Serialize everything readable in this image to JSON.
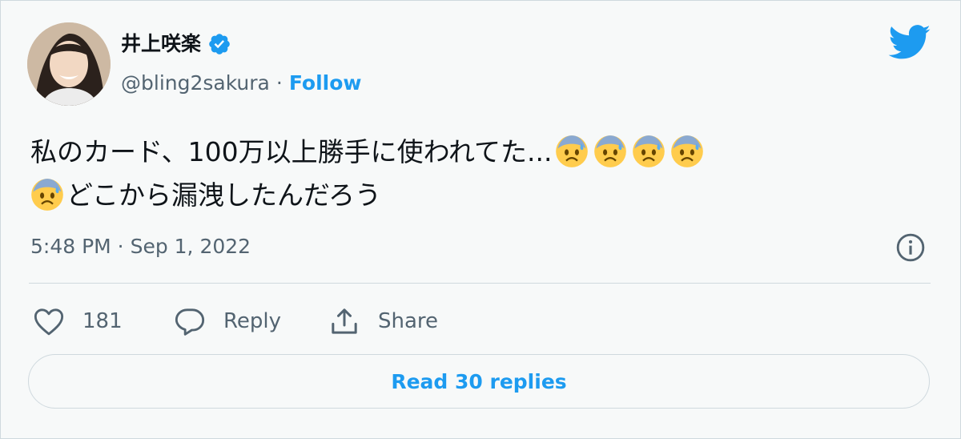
{
  "author": {
    "display_name": "井上咲楽",
    "handle": "@bling2sakura",
    "separator": "·",
    "follow_label": "Follow",
    "verified": true
  },
  "tweet": {
    "text_line1": "私のカード、100万以上勝手に使われてた...",
    "text_line2": "どこから漏洩したんだろう",
    "emoji": "anxious-face-with-sweat",
    "timestamp": "5:48 PM · Sep 1, 2022"
  },
  "actions": {
    "like_count": "181",
    "reply_label": "Reply",
    "share_label": "Share"
  },
  "read_replies_label": "Read 30 replies",
  "colors": {
    "accent": "#1d9bf0",
    "text": "#0f1419",
    "muted": "#536471",
    "border": "#cfd9de",
    "background": "#f7f9f9"
  }
}
